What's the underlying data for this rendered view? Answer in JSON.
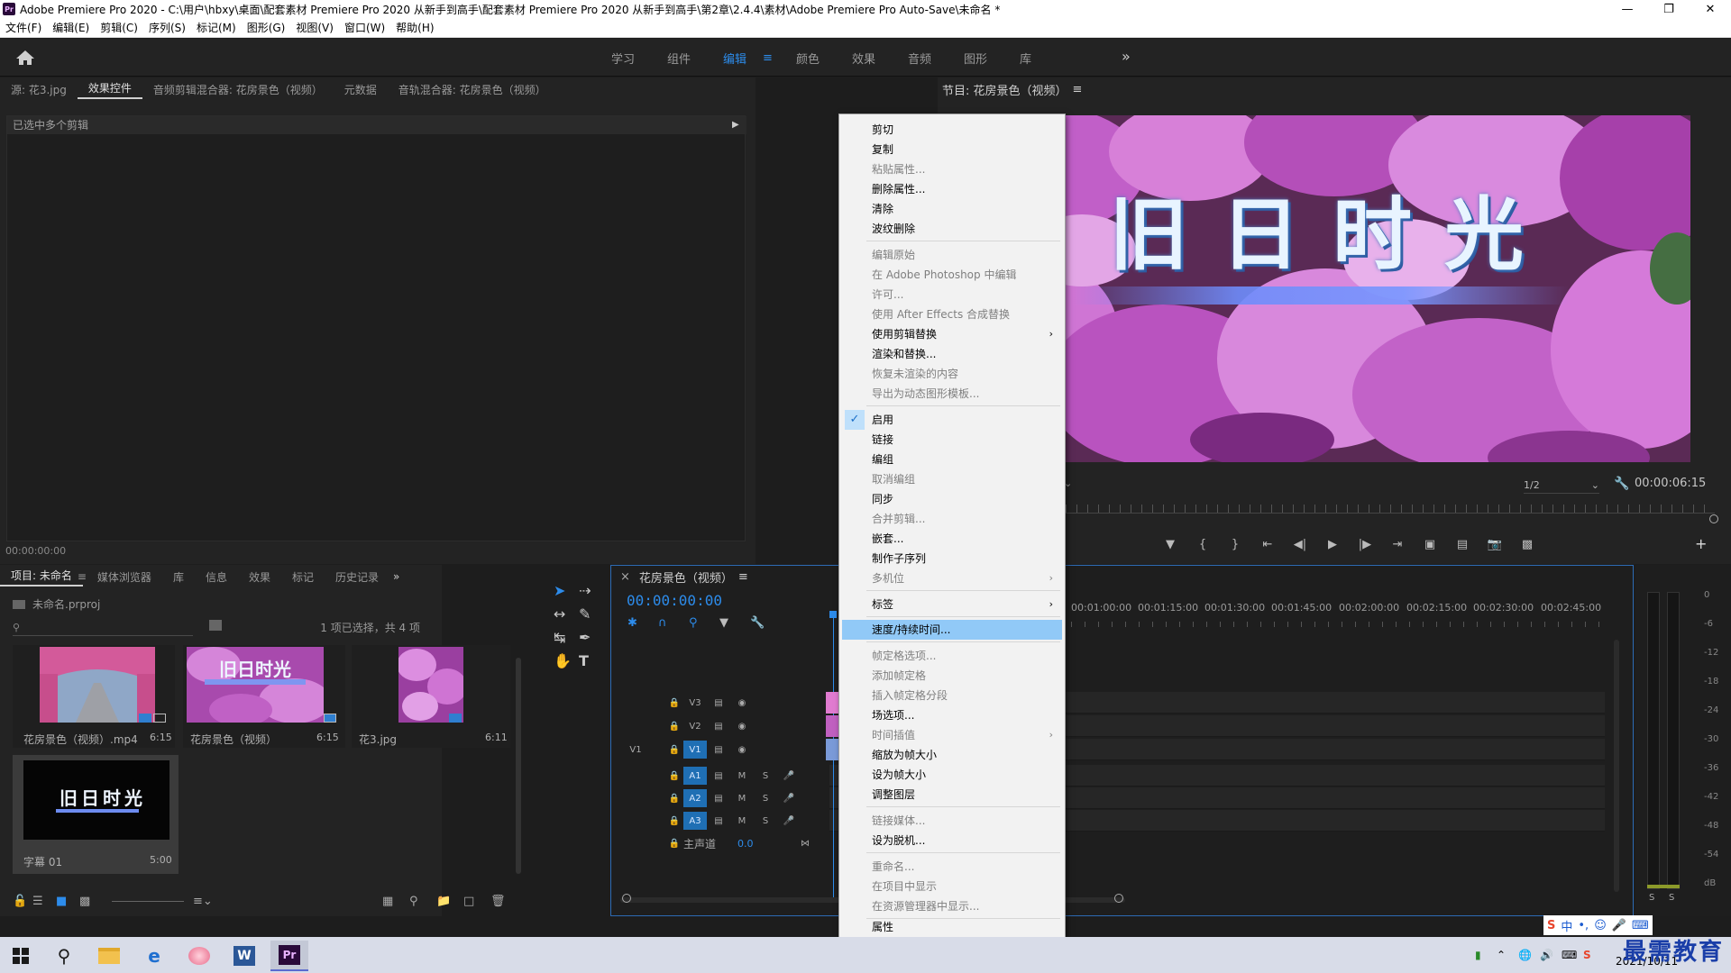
{
  "window": {
    "title": "Adobe Premiere Pro 2020 - C:\\用户\\hbxy\\桌面\\配套素材 Premiere Pro 2020 从新手到高手\\配套素材 Premiere Pro 2020 从新手到高手\\第2章\\2.4.4\\素材\\Adobe Premiere Pro Auto-Save\\未命名 *",
    "logo": "Pr"
  },
  "menubar": [
    "文件(F)",
    "编辑(E)",
    "剪辑(C)",
    "序列(S)",
    "标记(M)",
    "图形(G)",
    "视图(V)",
    "窗口(W)",
    "帮助(H)"
  ],
  "workspaces": {
    "tabs": [
      "学习",
      "组件",
      "编辑",
      "颜色",
      "效果",
      "音频",
      "图形",
      "库"
    ],
    "active": "编辑"
  },
  "source_panel": {
    "tabs": [
      "源: 花3.jpg",
      "效果控件",
      "音频剪辑混合器: 花房景色（视频）",
      "元数据",
      "音轨混合器: 花房景色（视频）"
    ],
    "active_tab": "效果控件",
    "header_text": "已选中多个剪辑",
    "timecode": "00:00:00:00"
  },
  "program_monitor": {
    "title": "节目: 花房景色（视频）",
    "overlay_title": "旧日时光",
    "resolution": "1/2",
    "timecode": "00:00:06:15"
  },
  "project_panel": {
    "tabs": [
      "项目: 未命名",
      "媒体浏览器",
      "库",
      "信息",
      "效果",
      "标记",
      "历史记录"
    ],
    "file": "未命名.prproj",
    "selection_status": "1 项已选择，共 4 项",
    "items": [
      {
        "name": "花房景色（视频）.mp4",
        "duration": "6:15"
      },
      {
        "name": "花房景色（视频）",
        "duration": "6:15"
      },
      {
        "name": "花3.jpg",
        "duration": "6:11"
      },
      {
        "name": "字幕 01",
        "duration": "5:00"
      }
    ],
    "caption_thumb_text": "旧日时光"
  },
  "timeline": {
    "sequence_name": "花房景色（视频）",
    "timecode": "00:00:00:00",
    "ruler": [
      "00:00",
      "00:01:00:00",
      "00:01:15:00",
      "00:01:30:00",
      "00:01:45:00",
      "00:02:00:00",
      "00:02:15:00",
      "00:02:30:00",
      "00:02:45:00"
    ],
    "video_tracks": [
      "V3",
      "V2",
      "V1"
    ],
    "audio_tracks": [
      "A1",
      "A2",
      "A3"
    ],
    "source_patch": "V1",
    "master": {
      "label": "主声道",
      "value": "0.0"
    },
    "track_toggles": {
      "mute": "M",
      "solo": "S"
    }
  },
  "audio_meter": {
    "scale": [
      "0",
      "-6",
      "-12",
      "-18",
      "-24",
      "-30",
      "-36",
      "-42",
      "-48",
      "-54",
      "dB"
    ],
    "solo_buttons": [
      "S",
      "S"
    ]
  },
  "context_menu": {
    "items": [
      {
        "label": "剪切",
        "enabled": true
      },
      {
        "label": "复制",
        "enabled": true
      },
      {
        "label": "粘贴属性...",
        "enabled": false
      },
      {
        "label": "删除属性...",
        "enabled": true
      },
      {
        "label": "清除",
        "enabled": true
      },
      {
        "label": "波纹删除",
        "enabled": true
      },
      {
        "label": "编辑原始",
        "enabled": false
      },
      {
        "label": "在 Adobe Photoshop 中编辑",
        "enabled": false
      },
      {
        "label": "许可...",
        "enabled": false
      },
      {
        "label": "使用 After Effects 合成替换",
        "enabled": false
      },
      {
        "label": "使用剪辑替换",
        "enabled": true,
        "submenu": true
      },
      {
        "label": "渲染和替换...",
        "enabled": true
      },
      {
        "label": "恢复未渲染的内容",
        "enabled": false
      },
      {
        "label": "导出为动态图形模板...",
        "enabled": false
      },
      {
        "label": "启用",
        "enabled": true,
        "checked": true
      },
      {
        "label": "链接",
        "enabled": true
      },
      {
        "label": "编组",
        "enabled": true
      },
      {
        "label": "取消编组",
        "enabled": false
      },
      {
        "label": "同步",
        "enabled": true
      },
      {
        "label": "合并剪辑...",
        "enabled": false
      },
      {
        "label": "嵌套...",
        "enabled": true
      },
      {
        "label": "制作子序列",
        "enabled": true
      },
      {
        "label": "多机位",
        "enabled": false,
        "submenu": true
      },
      {
        "label": "标签",
        "enabled": true,
        "submenu": true
      },
      {
        "label": "速度/持续时间...",
        "enabled": true,
        "highlighted": true
      },
      {
        "label": "帧定格选项...",
        "enabled": false
      },
      {
        "label": "添加帧定格",
        "enabled": false
      },
      {
        "label": "插入帧定格分段",
        "enabled": false
      },
      {
        "label": "场选项...",
        "enabled": true
      },
      {
        "label": "时间插值",
        "enabled": false,
        "submenu": true
      },
      {
        "label": "缩放为帧大小",
        "enabled": true
      },
      {
        "label": "设为帧大小",
        "enabled": true
      },
      {
        "label": "调整图层",
        "enabled": true
      },
      {
        "label": "链接媒体...",
        "enabled": false
      },
      {
        "label": "设为脱机...",
        "enabled": true
      },
      {
        "label": "重命名...",
        "enabled": false
      },
      {
        "label": "在项目中显示",
        "enabled": false
      },
      {
        "label": "在资源管理器中显示...",
        "enabled": false
      },
      {
        "label": "属性",
        "enabled": true
      }
    ]
  },
  "taskbar": {
    "date": "2021/10/11",
    "ime_lang": "中",
    "watermark": "最需教育"
  },
  "colors": {
    "accent": "#2d8ceb",
    "menu_highlight": "#91c9f7",
    "track_tag": "#1f6fb4"
  }
}
